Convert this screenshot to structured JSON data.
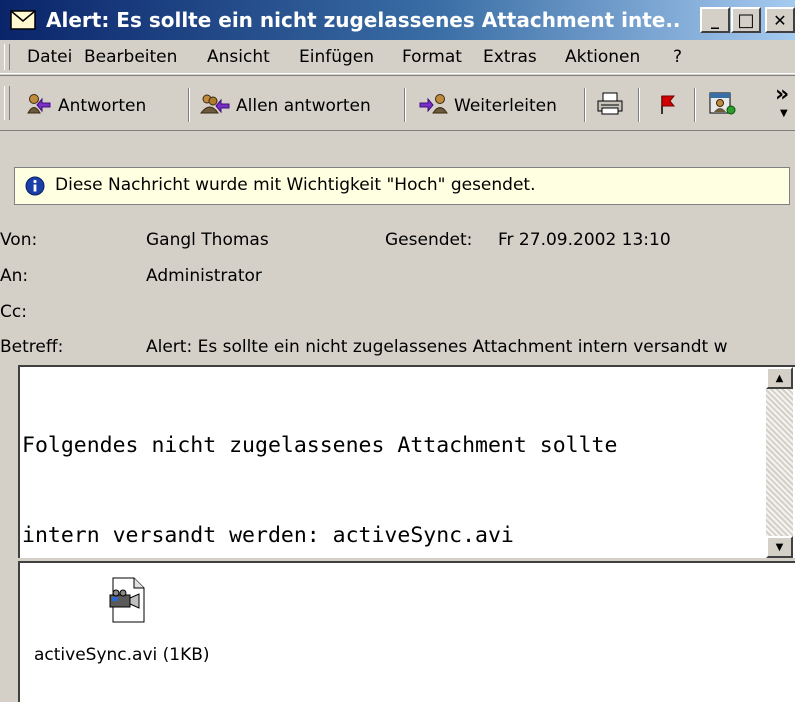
{
  "window": {
    "title": "Alert: Es sollte ein nicht zugelassenes Attachment inte...",
    "minimize_glyph": "_",
    "maximize_glyph": "□",
    "close_glyph": "✕"
  },
  "menu": {
    "items": [
      "Datei",
      "Bearbeiten",
      "Ansicht",
      "Einfügen",
      "Format",
      "Extras",
      "Aktionen",
      "?"
    ]
  },
  "toolbar": {
    "reply_label": "Antworten",
    "reply_all_label": "Allen antworten",
    "forward_label": "Weiterleiten",
    "overflow_glyph": "»"
  },
  "info": {
    "text": "Diese Nachricht wurde mit Wichtigkeit \"Hoch\" gesendet."
  },
  "header": {
    "from_label": "Von:",
    "from_value": "Gangl Thomas",
    "sent_label": "Gesendet:",
    "sent_value": "Fr 27.09.2002 13:10",
    "to_label": "An:",
    "to_value": "Administrator",
    "cc_label": "Cc:",
    "cc_value": "",
    "subject_label": "Betreff:",
    "subject_value": "Alert: Es sollte ein nicht zugelassenes Attachment intern versandt w"
  },
  "body": {
    "lines": [
      "Folgendes nicht zugelassenes Attachment sollte",
      "intern versandt werden: activeSync.avi"
    ]
  },
  "attachment": {
    "label": "activeSync.avi (1KB)"
  },
  "colors": {
    "titlebar": "#0a246a",
    "infobar": "#ffffe1",
    "chrome": "#d4d0c8"
  }
}
